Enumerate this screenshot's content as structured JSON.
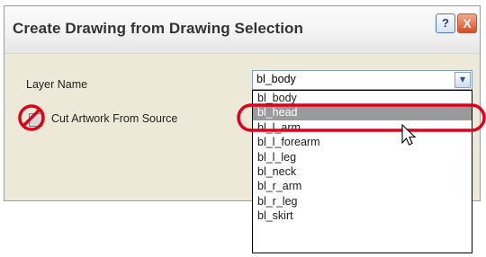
{
  "window": {
    "title": "Create Drawing from Drawing Selection",
    "help_icon": "?",
    "close_icon": "X"
  },
  "form": {
    "layer_name_label": "Layer Name",
    "layer_name_value": "bl_body",
    "cut_artwork_label": "Cut Artwork From Source",
    "cut_artwork_checked": false
  },
  "dropdown": {
    "options": [
      "bl_body",
      "bl_head",
      "bl_l_arm",
      "bl_l_forearm",
      "bl_l_leg",
      "bl_neck",
      "bl_r_arm",
      "bl_r_leg",
      "bl_skirt"
    ],
    "highlighted_index": 1,
    "arrow_icon": "chevron-down-icon"
  },
  "annotations": {
    "highlight_color": "#e0001a",
    "annotation_shapes": [
      "no-symbol-circle",
      "ellipse-highlight"
    ]
  }
}
